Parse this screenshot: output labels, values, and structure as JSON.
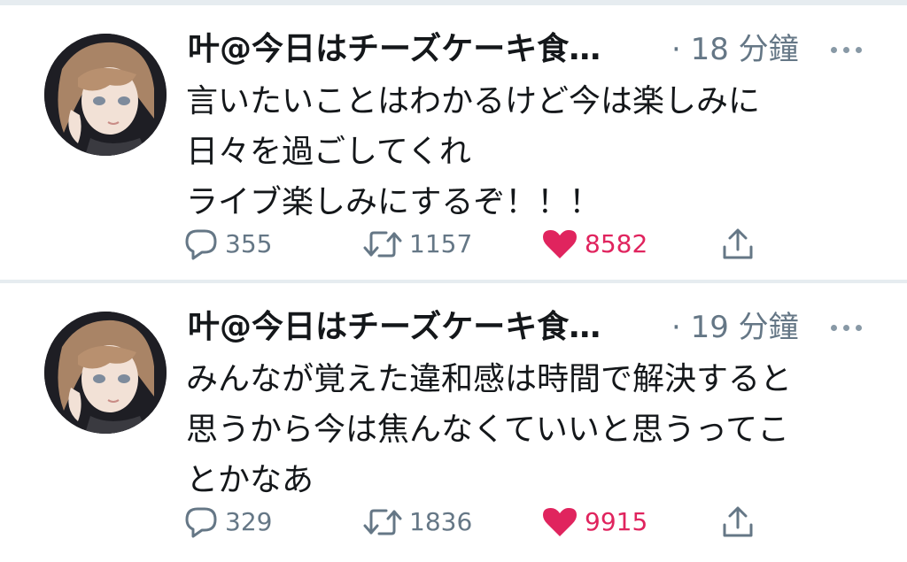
{
  "colors": {
    "text": "#14171a",
    "muted": "#657786",
    "like": "#e0245e",
    "divider": "#e6ecf0"
  },
  "tweets": [
    {
      "author_name": "叶@今日はチーズケーキ食…",
      "time": "· 18 分鐘",
      "lines": [
        "言いたいことはわかるけど今は楽しみに",
        "日々を過ごしてくれ",
        "ライブ楽しみにするぞ！！！"
      ],
      "reply_count": "355",
      "retweet_count": "1157",
      "like_count": "8582",
      "liked": true,
      "icons": {
        "reply": "reply-icon",
        "retweet": "retweet-icon",
        "like": "heart-icon",
        "share": "share-icon",
        "more": "more-icon"
      }
    },
    {
      "author_name": "叶@今日はチーズケーキ食…",
      "time": "· 19 分鐘",
      "lines": [
        "みんなが覚えた違和感は時間で解決すると",
        "思うから今は焦んなくていいと思うってこ",
        "とかなあ"
      ],
      "reply_count": "329",
      "retweet_count": "1836",
      "like_count": "9915",
      "liked": true,
      "icons": {
        "reply": "reply-icon",
        "retweet": "retweet-icon",
        "like": "heart-icon",
        "share": "share-icon",
        "more": "more-icon"
      }
    }
  ]
}
